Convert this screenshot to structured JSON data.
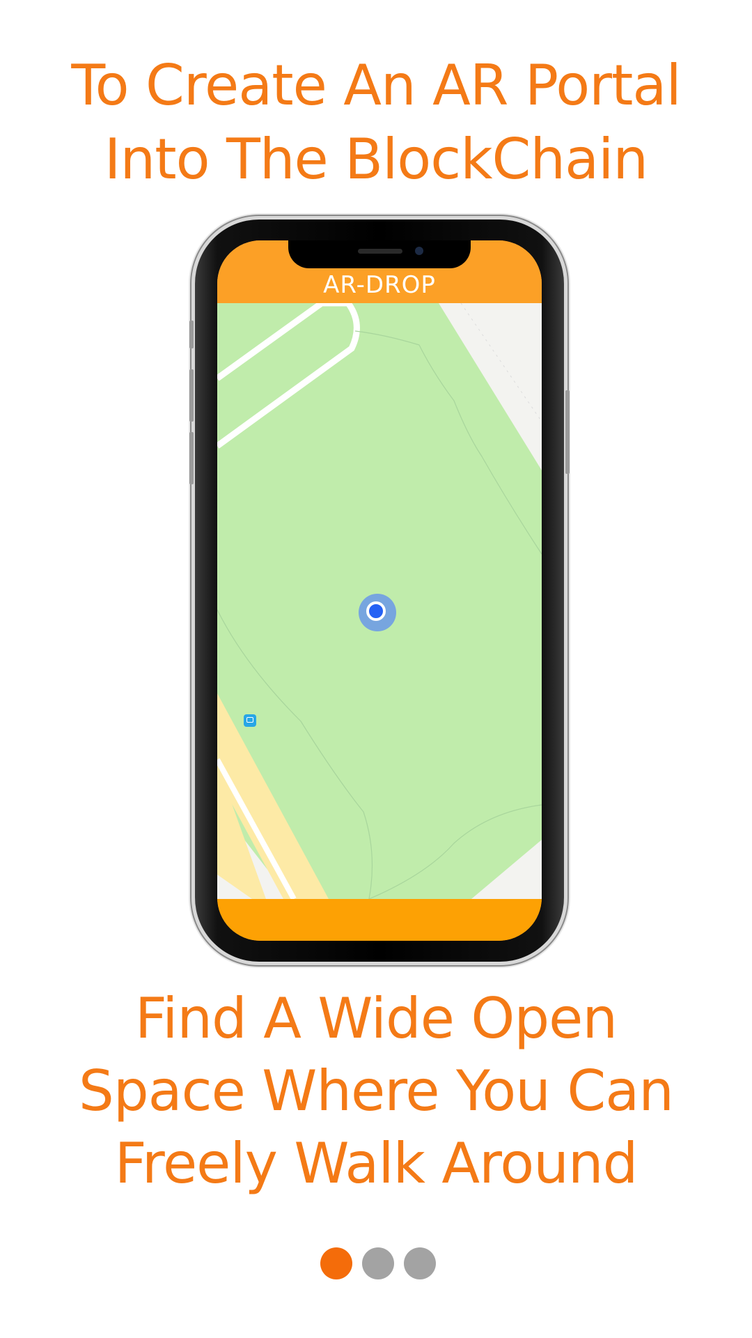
{
  "onboarding": {
    "top_headline": {
      "line1": "To Create An AR Portal",
      "line2": "Into The BlockChain"
    },
    "bottom_headline": {
      "line1": "Find A Wide Open",
      "line2": "Space Where You Can",
      "line3": "Freely Walk Around"
    },
    "page_indicator": {
      "total": 3,
      "current": 1
    }
  },
  "phone_screen": {
    "app_logo": "AR-DROP",
    "map": {
      "icons": [
        "location-dot-icon",
        "bus-stop-icon"
      ]
    }
  },
  "colors": {
    "accent_text": "#f47a16",
    "app_header": "#fca026",
    "bottom_bar": "#fda104",
    "map_park": "#c0ecab",
    "dot_active": "#f46c0a",
    "dot_inactive": "#a3a3a3",
    "location_dot": "#2561f4"
  }
}
